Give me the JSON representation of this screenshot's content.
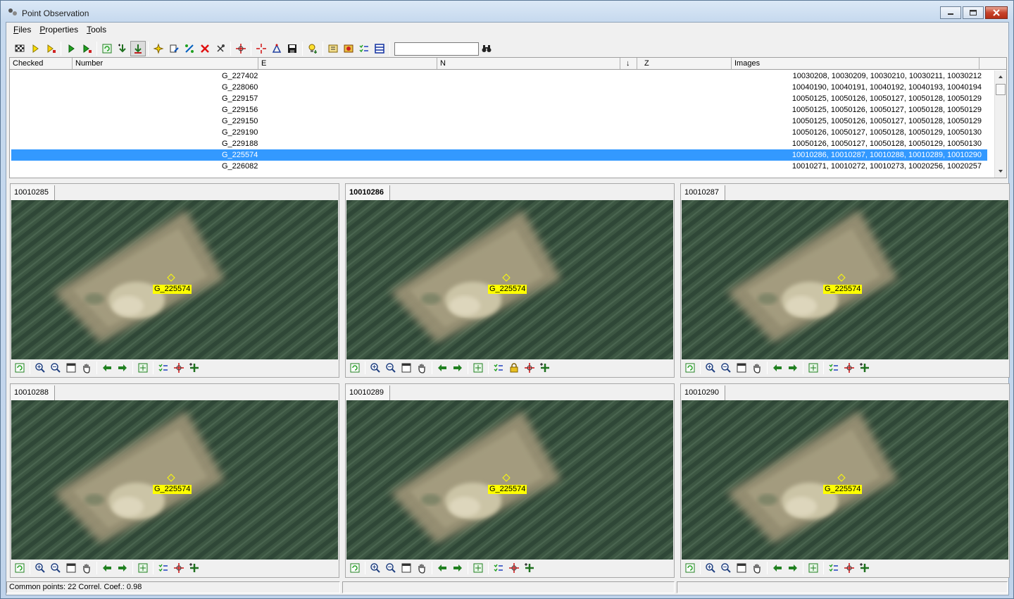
{
  "window": {
    "title": "Point Observation"
  },
  "menu": [
    {
      "label": "Files",
      "u": "F",
      "rest": "iles"
    },
    {
      "label": "Properties",
      "u": "P",
      "rest": "roperties"
    },
    {
      "label": "Tools",
      "u": "T",
      "rest": "ools"
    }
  ],
  "search": {
    "value": ""
  },
  "grid": {
    "columns": [
      "Checked",
      "Number",
      "E",
      "N",
      "↓",
      "Z",
      "Images"
    ],
    "rows": [
      {
        "number": "G_227402",
        "images": "10030208, 10030209, 10030210, 10030211, 10030212"
      },
      {
        "number": "G_228060",
        "images": "10040190, 10040191, 10040192, 10040193, 10040194"
      },
      {
        "number": "G_229157",
        "images": "10050125, 10050126, 10050127, 10050128, 10050129"
      },
      {
        "number": "G_229156",
        "images": "10050125, 10050126, 10050127, 10050128, 10050129"
      },
      {
        "number": "G_229150",
        "images": "10050125, 10050126, 10050127, 10050128, 10050129"
      },
      {
        "number": "G_229190",
        "images": "10050126, 10050127, 10050128, 10050129, 10050130"
      },
      {
        "number": "G_229188",
        "images": "10050126, 10050127, 10050128, 10050129, 10050130"
      },
      {
        "number": "G_225574",
        "images": "10010286, 10010287, 10010288, 10010289, 10010290",
        "selected": true
      },
      {
        "number": "G_226082",
        "images": "10010271, 10010272, 10010273, 10020256, 10020257"
      }
    ]
  },
  "panes": [
    {
      "tab": "10010285",
      "point": "G_225574",
      "active": false
    },
    {
      "tab": "10010286",
      "point": "G_225574",
      "active": true
    },
    {
      "tab": "10010287",
      "point": "G_225574",
      "active": false
    },
    {
      "tab": "10010288",
      "point": "G_225574",
      "active": false
    },
    {
      "tab": "10010289",
      "point": "G_225574",
      "active": false
    },
    {
      "tab": "10010290",
      "point": "G_225574",
      "active": false
    }
  ],
  "status": {
    "text": "Common points: 22  Correl. Coef.: 0.98"
  },
  "colors": {
    "selection": "#3399ff",
    "point_label": "#ffff00"
  }
}
